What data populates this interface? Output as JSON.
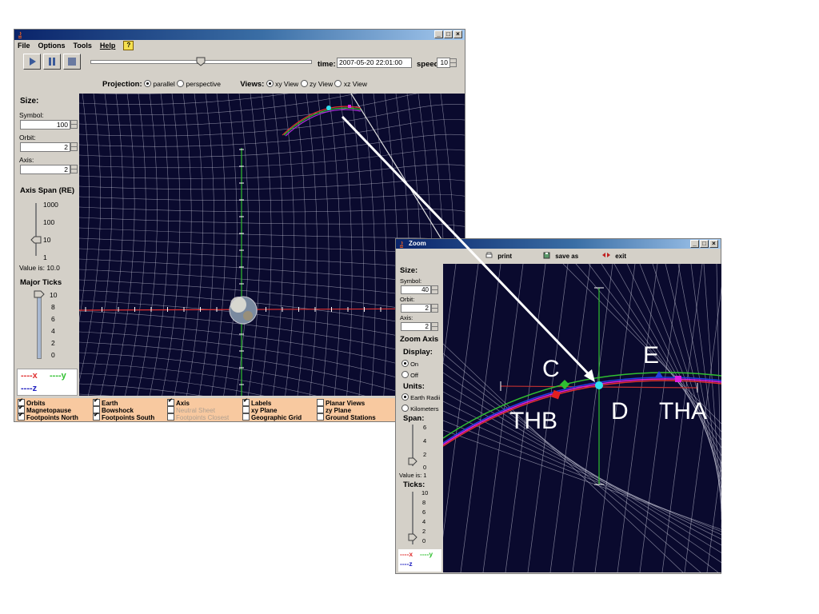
{
  "main_window": {
    "menu": [
      "File",
      "Options",
      "Tools",
      "Help"
    ],
    "help_badge": "?",
    "time_label": "time:",
    "time_value": "2007-05-20  22:01:00",
    "speed_label": "speed:",
    "speed_value": "10",
    "time_slider_fraction": 0.5,
    "projection_label": "Projection:",
    "projection_options": [
      {
        "label": "parallel",
        "selected": true
      },
      {
        "label": "perspective",
        "selected": false
      }
    ],
    "views_label": "Views:",
    "view_options": [
      {
        "label": "xy View",
        "selected": true
      },
      {
        "label": "zy View",
        "selected": false
      },
      {
        "label": "xz View",
        "selected": false
      }
    ],
    "size_header": "Size:",
    "symbol_label": "Symbol:",
    "symbol_value": "100",
    "orbit_label": "Orbit:",
    "orbit_value": "2",
    "axis_label": "Axis:",
    "axis_value": "2",
    "axis_span_header": "Axis Span (RE)",
    "axis_span_ticks": [
      "1000",
      "100",
      "10",
      "1"
    ],
    "axis_span_value_text": "Value is: 10.0",
    "major_ticks_header": "Major Ticks",
    "major_ticks_values": [
      "10",
      "8",
      "6",
      "4",
      "2",
      "0"
    ],
    "legend": {
      "x": "x",
      "y": "y",
      "z": "z"
    },
    "checkboxes": [
      [
        {
          "label": "Orbits",
          "checked": true,
          "enabled": true
        },
        {
          "label": "Magnetopause",
          "checked": true,
          "enabled": true
        },
        {
          "label": "Footpoints North",
          "checked": true,
          "enabled": true
        }
      ],
      [
        {
          "label": "Earth",
          "checked": true,
          "enabled": true
        },
        {
          "label": "Bowshock",
          "checked": false,
          "enabled": true
        },
        {
          "label": "Footpoints South",
          "checked": true,
          "enabled": true
        }
      ],
      [
        {
          "label": "Axis",
          "checked": true,
          "enabled": true
        },
        {
          "label": "Neutral Sheet",
          "checked": false,
          "enabled": false
        },
        {
          "label": "Footpoints Closest",
          "checked": false,
          "enabled": false
        }
      ],
      [
        {
          "label": "Labels",
          "checked": true,
          "enabled": true
        },
        {
          "label": "xy Plane",
          "checked": false,
          "enabled": true
        },
        {
          "label": "Geographic Grid",
          "checked": false,
          "enabled": true
        }
      ],
      [
        {
          "label": "Planar Views",
          "checked": false,
          "enabled": true
        },
        {
          "label": "zy Plane",
          "checked": false,
          "enabled": true
        },
        {
          "label": "Ground Stations",
          "checked": false,
          "enabled": true
        }
      ]
    ]
  },
  "zoom_window": {
    "title": "Zoom",
    "print_label": "print",
    "save_label": "save as",
    "exit_label": "exit",
    "size_header": "Size:",
    "symbol_label": "Symbol:",
    "symbol_value": "40",
    "orbit_label": "Orbit:",
    "orbit_value": "2",
    "axis_label": "Axis:",
    "axis_value": "2",
    "zoom_axis_header": "Zoom Axis",
    "display_header": "Display:",
    "display_options": [
      {
        "label": "On",
        "selected": true
      },
      {
        "label": "Off",
        "selected": false
      }
    ],
    "units_header": "Units:",
    "unit_options": [
      {
        "label": "Earth Radii",
        "selected": true
      },
      {
        "label": "Kilometers",
        "selected": false
      }
    ],
    "span_header": "Span:",
    "span_ticks": [
      "6",
      "4",
      "2",
      "0"
    ],
    "span_value_text": "Value is: 1",
    "ticks_header": "Ticks:",
    "ticks_values": [
      "10",
      "8",
      "6",
      "4",
      "2",
      "0"
    ],
    "legend": {
      "x": "x",
      "y": "y",
      "z": "z"
    }
  },
  "annotations": {
    "C": "C",
    "D": "D",
    "E": "E",
    "THB": "THB",
    "THA": "THA"
  },
  "colors": {
    "space": "#0a0a2e",
    "x_axis": "#e03030",
    "y_axis": "#30c030",
    "z_axis": "#2020c0",
    "orange_panel": "#f8c9a0",
    "d_marker": "#30e0f0",
    "thb_marker": "#e02020",
    "thd_marker": "#30c030",
    "the_marker": "#2040e0",
    "tha_marker": "#e020e0"
  }
}
